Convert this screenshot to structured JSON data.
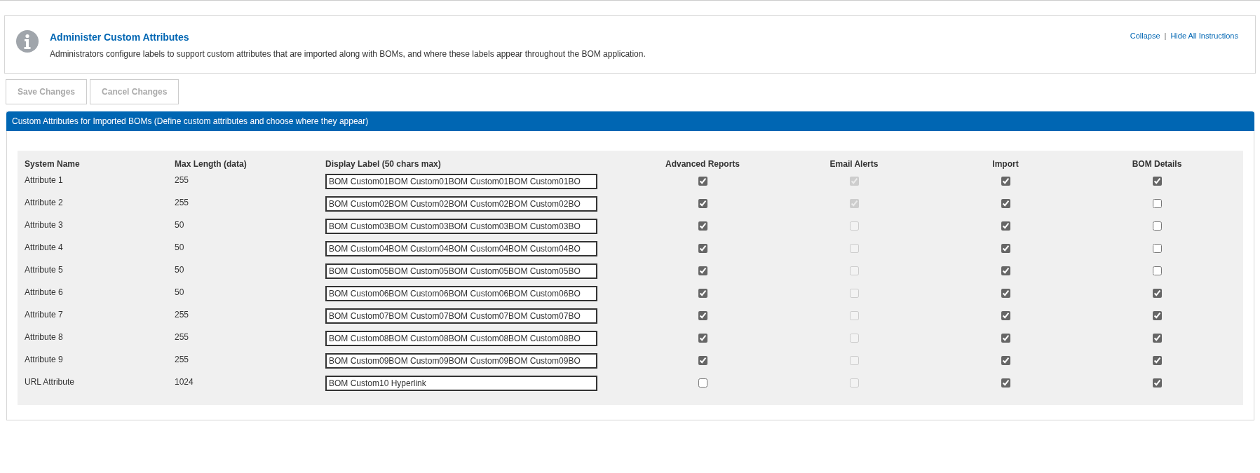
{
  "instructions": {
    "title": "Administer Custom Attributes",
    "text": "Administrators configure labels to support custom attributes that are imported along with BOMs, and where these labels appear throughout the BOM application.",
    "links": [
      "Collapse",
      "Hide All Instructions"
    ],
    "separator": "|"
  },
  "buttons": [
    {
      "label": "Save Changes",
      "disabled": true
    },
    {
      "label": "Cancel Changes",
      "disabled": true
    }
  ],
  "panel": {
    "title": "Custom Attributes for Imported BOMs (Define custom attributes and choose where they appear)"
  },
  "table": {
    "columns": [
      "System Name",
      "Max Length (data)",
      "Display Label (50 chars max)",
      "Advanced Reports",
      "Email Alerts",
      "Import",
      "BOM Details"
    ],
    "rows": [
      {
        "system_name": "Attribute 1",
        "max_length": "255",
        "display_label": "BOM Custom01BOM Custom01BOM Custom01BOM Custom01BO",
        "checks": [
          {
            "checked": true,
            "disabled": false
          },
          {
            "checked": true,
            "disabled": true
          },
          {
            "checked": true,
            "disabled": false
          },
          {
            "checked": true,
            "disabled": false
          }
        ]
      },
      {
        "system_name": "Attribute 2",
        "max_length": "255",
        "display_label": "BOM Custom02BOM Custom02BOM Custom02BOM Custom02BO",
        "checks": [
          {
            "checked": true,
            "disabled": false
          },
          {
            "checked": true,
            "disabled": true
          },
          {
            "checked": true,
            "disabled": false
          },
          {
            "checked": false,
            "disabled": false
          }
        ]
      },
      {
        "system_name": "Attribute 3",
        "max_length": "50",
        "display_label": "BOM Custom03BOM Custom03BOM Custom03BOM Custom03BO",
        "checks": [
          {
            "checked": true,
            "disabled": false
          },
          {
            "checked": false,
            "disabled": true
          },
          {
            "checked": true,
            "disabled": false
          },
          {
            "checked": false,
            "disabled": false
          }
        ]
      },
      {
        "system_name": "Attribute 4",
        "max_length": "50",
        "display_label": "BOM Custom04BOM Custom04BOM Custom04BOM Custom04BO",
        "checks": [
          {
            "checked": true,
            "disabled": false
          },
          {
            "checked": false,
            "disabled": true
          },
          {
            "checked": true,
            "disabled": false
          },
          {
            "checked": false,
            "disabled": false
          }
        ]
      },
      {
        "system_name": "Attribute 5",
        "max_length": "50",
        "display_label": "BOM Custom05BOM Custom05BOM Custom05BOM Custom05BO",
        "checks": [
          {
            "checked": true,
            "disabled": false
          },
          {
            "checked": false,
            "disabled": true
          },
          {
            "checked": true,
            "disabled": false
          },
          {
            "checked": false,
            "disabled": false
          }
        ]
      },
      {
        "system_name": "Attribute 6",
        "max_length": "50",
        "display_label": "BOM Custom06BOM Custom06BOM Custom06BOM Custom06BO",
        "checks": [
          {
            "checked": true,
            "disabled": false
          },
          {
            "checked": false,
            "disabled": true
          },
          {
            "checked": true,
            "disabled": false
          },
          {
            "checked": true,
            "disabled": false
          }
        ]
      },
      {
        "system_name": "Attribute 7",
        "max_length": "255",
        "display_label": "BOM Custom07BOM Custom07BOM Custom07BOM Custom07BO",
        "checks": [
          {
            "checked": true,
            "disabled": false
          },
          {
            "checked": false,
            "disabled": true
          },
          {
            "checked": true,
            "disabled": false
          },
          {
            "checked": true,
            "disabled": false
          }
        ]
      },
      {
        "system_name": "Attribute 8",
        "max_length": "255",
        "display_label": "BOM Custom08BOM Custom08BOM Custom08BOM Custom08BO",
        "checks": [
          {
            "checked": true,
            "disabled": false
          },
          {
            "checked": false,
            "disabled": true
          },
          {
            "checked": true,
            "disabled": false
          },
          {
            "checked": true,
            "disabled": false
          }
        ]
      },
      {
        "system_name": "Attribute 9",
        "max_length": "255",
        "display_label": "BOM Custom09BOM Custom09BOM Custom09BOM Custom09BO",
        "checks": [
          {
            "checked": true,
            "disabled": false
          },
          {
            "checked": false,
            "disabled": true
          },
          {
            "checked": true,
            "disabled": false
          },
          {
            "checked": true,
            "disabled": false
          }
        ]
      },
      {
        "system_name": "URL Attribute",
        "max_length": "1024",
        "display_label": "BOM Custom10 Hyperlink",
        "checks": [
          {
            "checked": false,
            "disabled": false
          },
          {
            "checked": false,
            "disabled": true
          },
          {
            "checked": true,
            "disabled": false
          },
          {
            "checked": true,
            "disabled": false
          }
        ]
      }
    ]
  }
}
